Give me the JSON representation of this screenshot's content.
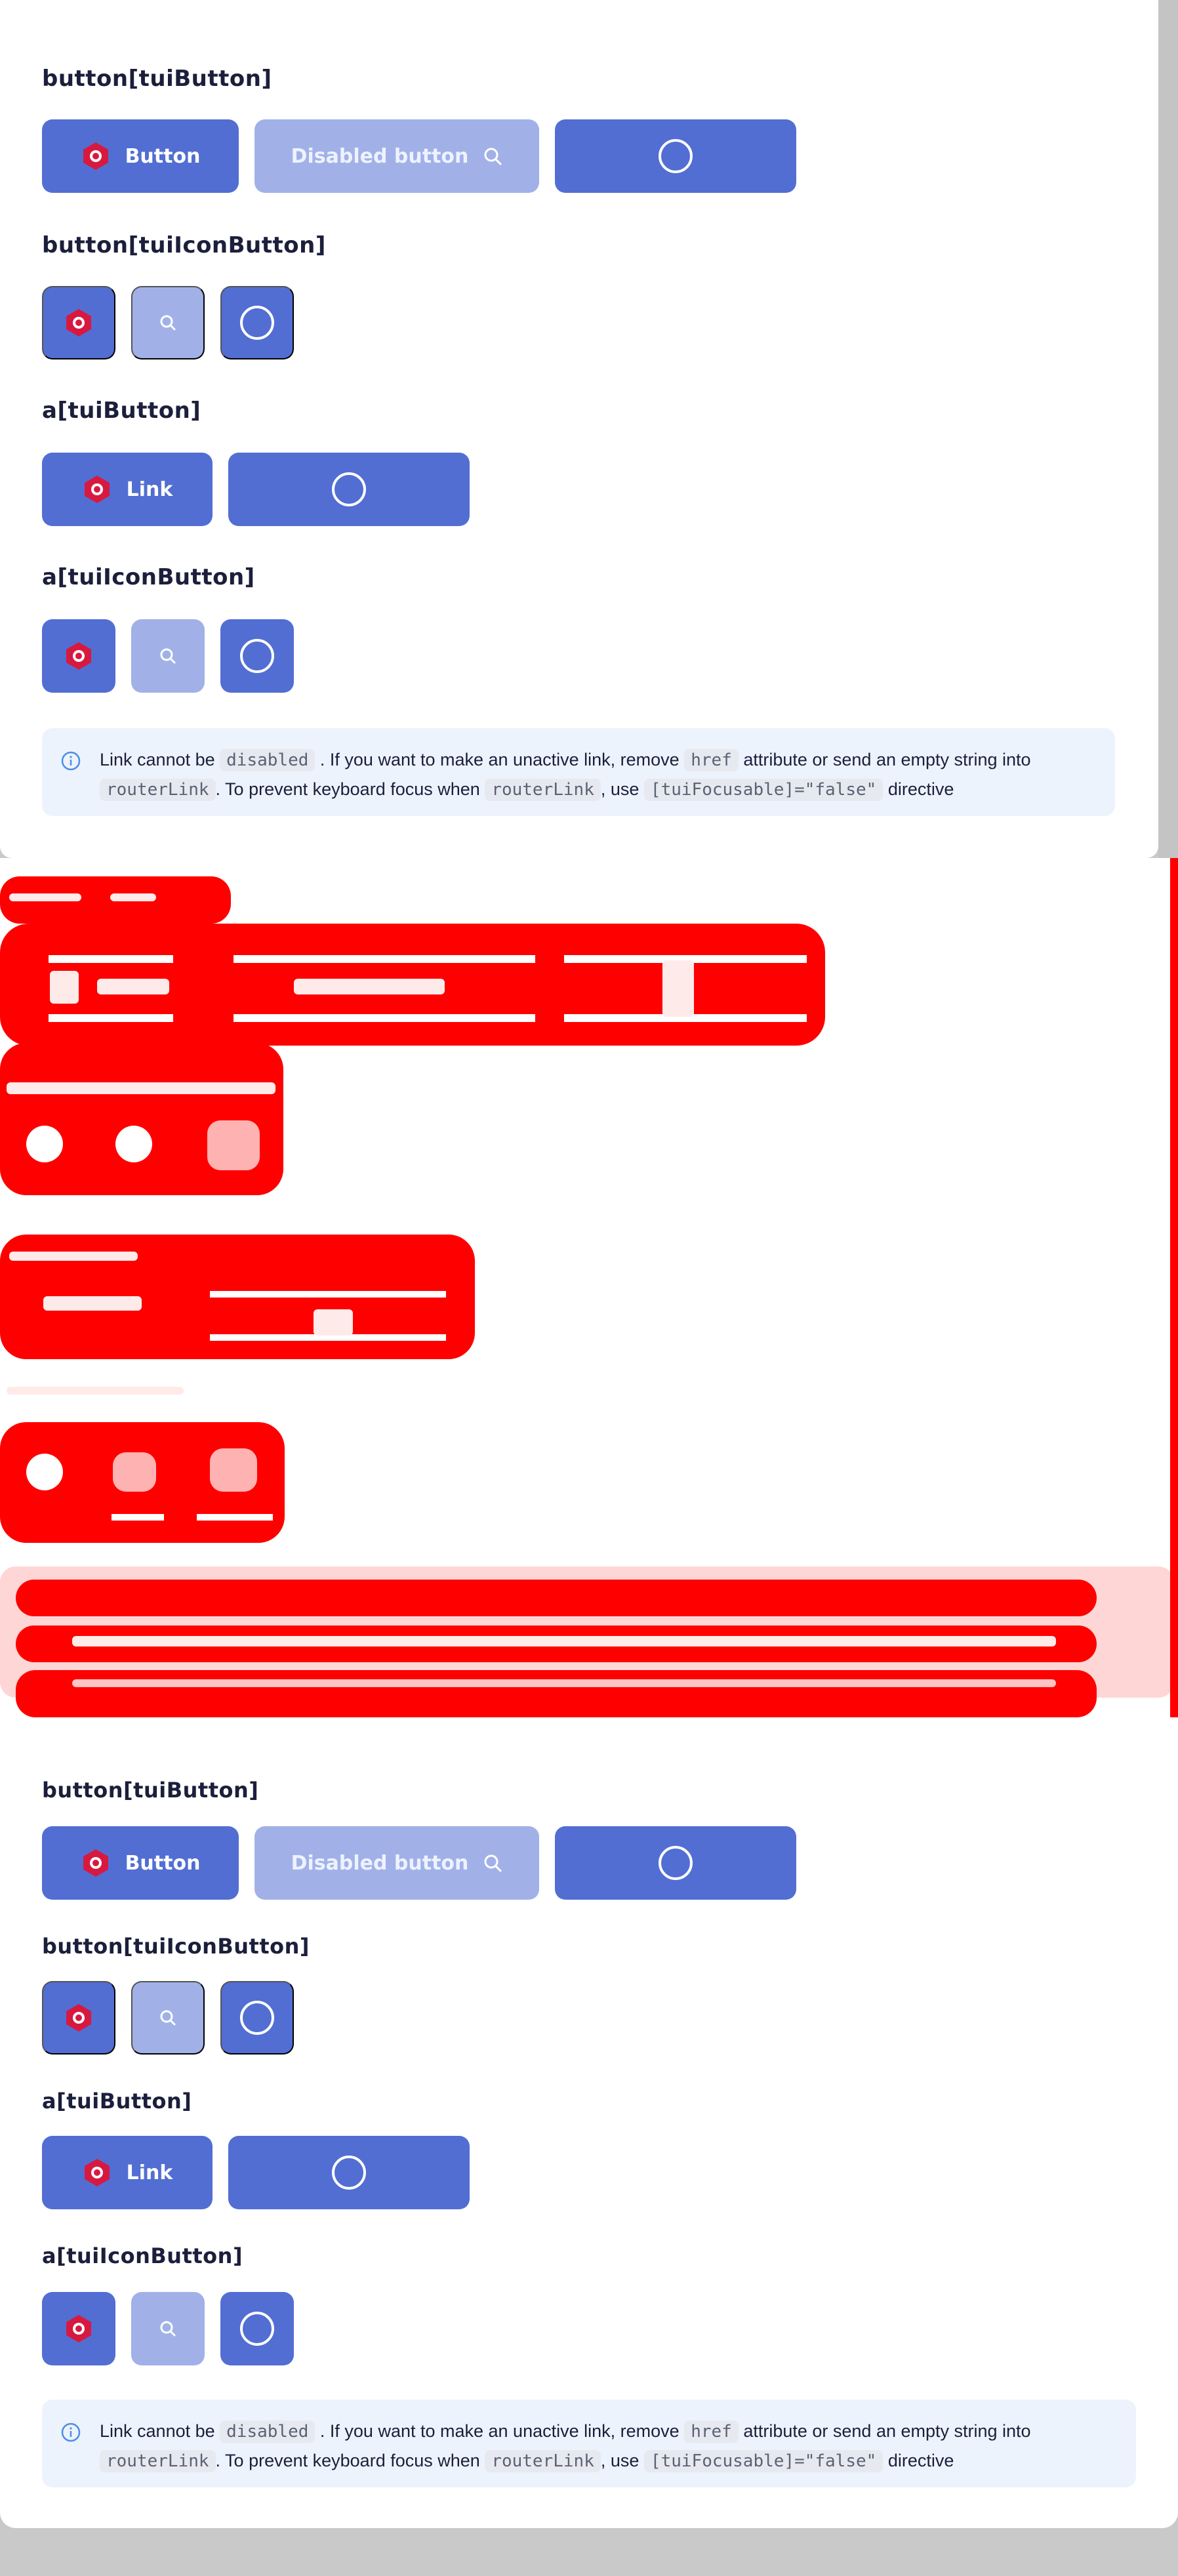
{
  "colors": {
    "primary": "#526ed3",
    "primary_disabled": "#a1b1e8",
    "notice_bg": "#edf3fc",
    "diff_red": "#ff0000"
  },
  "icons": {
    "logo": "taiga-hex-logo-icon",
    "search": "search-icon",
    "loader": "loader-circle-icon",
    "info": "info-icon"
  },
  "demo": {
    "button_title": "button[tuiButton]",
    "button_label": "Button",
    "disabled_label": "Disabled button",
    "icon_button_title": "button[tuiIconButton]",
    "link_title": "a[tuiButton]",
    "link_label": "Link",
    "icon_link_title": "a[tuiIconButton]",
    "notice": {
      "t1": "Link cannot be",
      "c1": "disabled",
      "t2": ". If you want to make an unactive link, remove",
      "c2": "href",
      "t3": "attribute or send an empty string into",
      "c3": "routerLink",
      "t4": ". To prevent keyboard focus when",
      "c4": "routerLink",
      "t5": ", use",
      "c5": "[tuiFocusable]=\"false\"",
      "t6": "directive"
    }
  }
}
